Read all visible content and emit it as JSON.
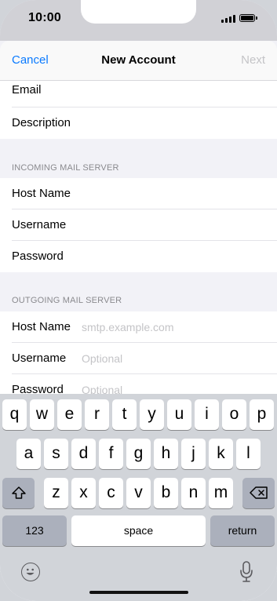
{
  "status_bar": {
    "time": "10:00"
  },
  "nav": {
    "cancel": "Cancel",
    "title": "New Account",
    "next": "Next"
  },
  "top_rows": {
    "email": "Email",
    "description": "Description"
  },
  "incoming": {
    "header": "INCOMING MAIL SERVER",
    "host_name": "Host Name",
    "username": "Username",
    "password": "Password"
  },
  "outgoing": {
    "header": "OUTGOING MAIL SERVER",
    "host_name": "Host Name",
    "host_placeholder": "smtp.example.com",
    "username": "Username",
    "username_placeholder": "Optional",
    "password": "Password",
    "password_placeholder": "Optional"
  },
  "keyboard": {
    "row1": [
      "q",
      "w",
      "e",
      "r",
      "t",
      "y",
      "u",
      "i",
      "o",
      "p"
    ],
    "row2": [
      "a",
      "s",
      "d",
      "f",
      "g",
      "h",
      "j",
      "k",
      "l"
    ],
    "row3": [
      "z",
      "x",
      "c",
      "v",
      "b",
      "n",
      "m"
    ],
    "numbers": "123",
    "space": "space",
    "return": "return"
  },
  "icons": {
    "shift": "shift-icon",
    "delete": "delete-icon",
    "emoji": "emoji-icon",
    "mic": "microphone-icon"
  }
}
